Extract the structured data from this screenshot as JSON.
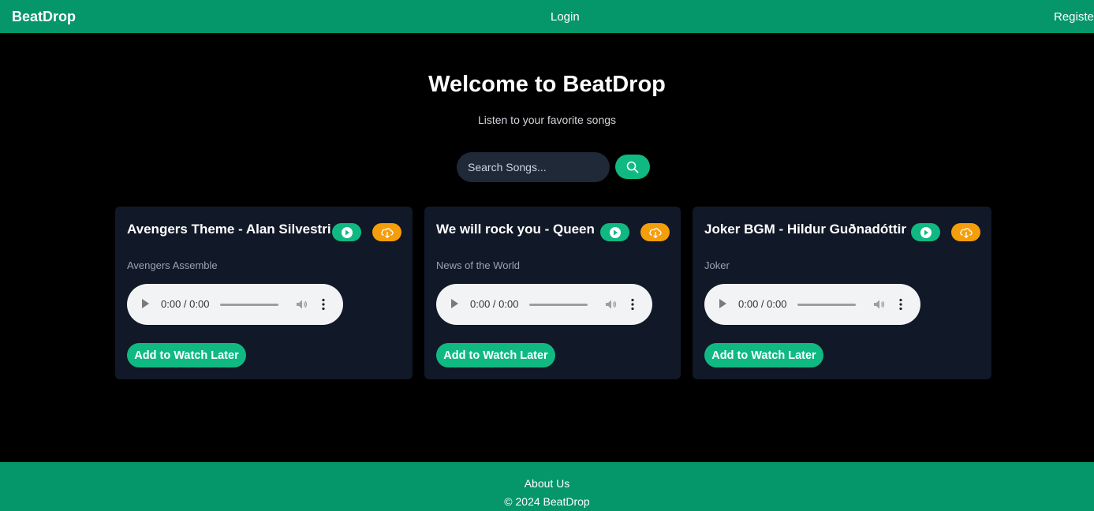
{
  "nav": {
    "brand": "BeatDrop",
    "login": "Login",
    "register": "Register"
  },
  "hero": {
    "title": "Welcome to BeatDrop",
    "subtitle": "Listen to your favorite songs"
  },
  "search": {
    "placeholder": "Search Songs...",
    "value": ""
  },
  "songs": [
    {
      "title": "Avengers Theme - Alan Silvestri",
      "album": "Avengers Assemble",
      "time": "0:00 / 0:00",
      "watch_label": "Add to Watch Later"
    },
    {
      "title": "We will rock you - Queen",
      "album": "News of the World",
      "time": "0:00 / 0:00",
      "watch_label": "Add to Watch Later"
    },
    {
      "title": "Joker BGM - Hildur Guðnadóttir",
      "album": "Joker",
      "time": "0:00 / 0:00",
      "watch_label": "Add to Watch Later"
    }
  ],
  "footer": {
    "about": "About Us",
    "copyright": "© 2024 BeatDrop"
  },
  "colors": {
    "brand_green": "#059669",
    "button_green": "#10b981",
    "orange": "#f59e0b",
    "card_bg": "#111827"
  }
}
